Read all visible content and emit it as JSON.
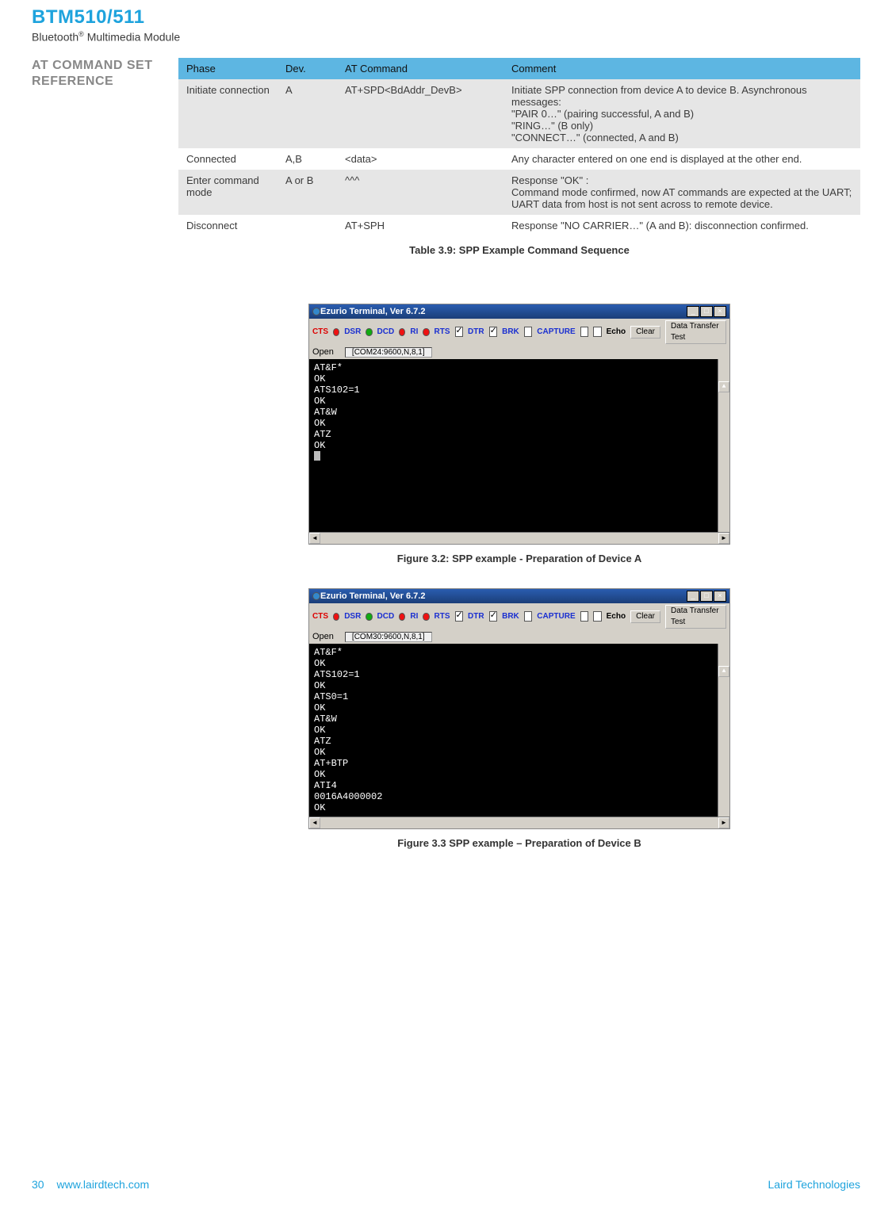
{
  "header": {
    "title": "BTM510/511",
    "subtitle_pre": "Bluetooth",
    "subtitle_sup": "®",
    "subtitle_post": " Multimedia Module"
  },
  "section_label_l1": "AT COMMAND SET",
  "section_label_l2": "REFERENCE",
  "table": {
    "head": {
      "c0": "Phase",
      "c1": "Dev.",
      "c2": "AT Command",
      "c3": "Comment"
    },
    "rows": [
      {
        "phase": "Initiate connection",
        "dev": "A",
        "cmd": "AT+SPD<BdAddr_DevB>",
        "comment": "Initiate SPP connection from device A to device B. Asynchronous messages:\n\"PAIR 0…\"        (pairing successful, A and B)\n\"RING…\"           (B only)\n\"CONNECT…\"  (connected, A and B)"
      },
      {
        "phase": "Connected",
        "dev": "A,B",
        "cmd": "<data>",
        "comment": "Any character entered on one end is displayed at the other end."
      },
      {
        "phase": "Enter command mode",
        "dev": "A or B",
        "cmd": "^^^",
        "comment": "Response \"OK\" :\nCommand mode confirmed, now AT commands are expected at the UART; UART data from host is not sent across to remote device."
      },
      {
        "phase": "Disconnect",
        "dev": "",
        "cmd": "AT+SPH",
        "comment": "Response \"NO CARRIER…\" (A and B): disconnection confirmed."
      }
    ],
    "caption": "Table 3.9: SPP Example Command Sequence"
  },
  "terminal_common": {
    "title": "Ezurio Terminal, Ver 6.7.2",
    "cts": "CTS",
    "dsr": "DSR",
    "dcd": "DCD",
    "ri": "RI",
    "rts": "RTS",
    "dtr": "DTR",
    "brk": "BRK",
    "capture": "CAPTURE",
    "echo": "Echo",
    "clear_btn": "Clear",
    "dtt_btn": "Data Transfer Test",
    "open": "Open"
  },
  "terminalA": {
    "com": "[COM24:9600,N,8,1]",
    "body": "AT&F*\nOK\nATS102=1\nOK\nAT&W\nOK\nATZ\nOK",
    "caption": "Figure 3.2: SPP example - Preparation of Device A"
  },
  "terminalB": {
    "com": "[COM30:9600,N,8,1]",
    "body": "AT&F*\nOK\nATS102=1\nOK\nATS0=1\nOK\nAT&W\nOK\nATZ\nOK\nAT+BTP\nOK\nATI4\n0016A4000002\nOK",
    "caption": "Figure 3.3 SPP example – Preparation of Device B"
  },
  "footer": {
    "page": "30",
    "url": "www.lairdtech.com",
    "company": "Laird Technologies"
  }
}
